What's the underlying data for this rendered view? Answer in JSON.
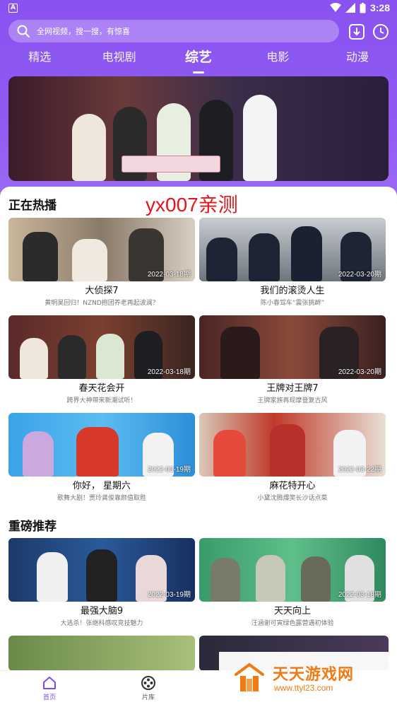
{
  "status_bar": {
    "time": "3:28",
    "app_icon": "A"
  },
  "search": {
    "placeholder": "全网视频，搜一搜，有惊喜"
  },
  "tabs": [
    {
      "label": "精选"
    },
    {
      "label": "电视剧"
    },
    {
      "label": "综艺",
      "active": true
    },
    {
      "label": "电影"
    },
    {
      "label": "动漫"
    }
  ],
  "watermark_text": "yx007亲测",
  "sections": {
    "hot": {
      "title": "正在热播"
    },
    "recommend": {
      "title": "重磅推荐"
    }
  },
  "hot_items": [
    {
      "title": "大侦探7",
      "subtitle": "黄明昊回归！NZND抱团养老再起波澜？",
      "date": "2022-03-18期"
    },
    {
      "title": "我们的滚烫人生",
      "subtitle": "陈小春驾车“震张挑衅”",
      "date": "2022-03-20期"
    },
    {
      "title": "春天花会开",
      "subtitle": "跨界大神带来新潮试听！",
      "date": "2022-03-18期"
    },
    {
      "title": "王牌对王牌7",
      "subtitle": "王牌家族再现摩登复古风",
      "date": "2022-03-20期"
    },
    {
      "title": "你好， 星期六",
      "subtitle": "歌舞大剧！贾玲龚俊靠颜值取胜",
      "date": "2022-03-19期"
    },
    {
      "title": "麻花特开心",
      "subtitle": "小黛沈腾爆笑长沙话点菜",
      "date": "2022-03-22期"
    }
  ],
  "recommend_items": [
    {
      "title": "最强大脑9",
      "subtitle": "大逃杀！张继科感叹竞技魅力",
      "date": "2022-03-19期"
    },
    {
      "title": "天天向上",
      "subtitle": "汪涵谢可寅绿色露营遇初体验",
      "date": "2022-03-18期"
    }
  ],
  "bottom_nav": [
    {
      "label": "首页",
      "active": true
    },
    {
      "label": "片库"
    }
  ],
  "site_logo": {
    "cn": "天天游戏网",
    "en": "www.ttyl23.com"
  },
  "colors": {
    "accent": "#8a52f0",
    "watermark": "#e5141a",
    "logo": "#f07a14"
  }
}
